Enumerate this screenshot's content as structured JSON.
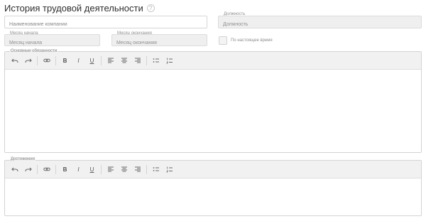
{
  "section": {
    "title": "История трудовой деятельности",
    "help_icon": "question-circle-icon",
    "help_glyph": "?"
  },
  "fields": {
    "company": {
      "placeholder": "Наименование компании"
    },
    "position": {
      "label": "Должность",
      "placeholder": "Должность"
    },
    "start_month": {
      "label": "Месяц начала",
      "placeholder": "Месяц начала"
    },
    "end_month": {
      "label": "Месяц окончания",
      "placeholder": "Месяц окончания"
    },
    "present_checkbox": {
      "label": "По настоящее время",
      "checked": false
    }
  },
  "editors": {
    "duties": {
      "label": "Основные обязанности"
    },
    "achievements": {
      "label": "Достижения"
    }
  },
  "toolbar": {
    "undo_icon": "undo-icon",
    "redo_icon": "redo-icon",
    "link_icon": "link-icon",
    "bold_text": "B",
    "italic_text": "I",
    "underline_text": "U",
    "align_left_icon": "align-left-icon",
    "align_center_icon": "align-center-icon",
    "align_right_icon": "align-right-icon",
    "bullet_list_icon": "bullet-list-icon",
    "numbered_list_icon": "numbered-list-icon"
  },
  "colors": {
    "toolbar_bg": "#f1f1f1",
    "disabled_field_bg": "#efefef",
    "border": "#d6d6d6"
  }
}
